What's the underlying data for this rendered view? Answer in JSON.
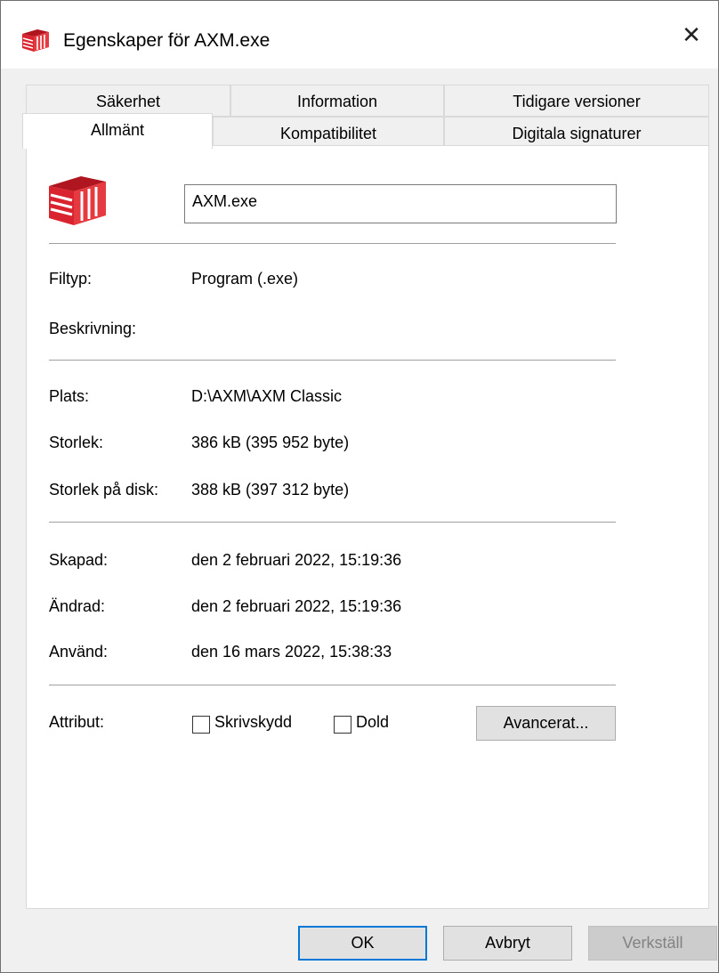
{
  "window": {
    "title": "Egenskaper för AXM.exe",
    "app_icon": "axm-logo-icon",
    "accent_color": "#d9232e"
  },
  "tabs": {
    "row1": [
      "Säkerhet",
      "Information",
      "Tidigare versioner"
    ],
    "row2": [
      "Allmänt",
      "Kompatibilitet",
      "Digitala signaturer"
    ],
    "active": "Allmänt"
  },
  "general": {
    "file_name": "AXM.exe",
    "filetype_label": "Filtyp:",
    "filetype_value": "Program (.exe)",
    "description_label": "Beskrivning:",
    "location_label": "Plats:",
    "location_value": "D:\\AXM\\AXM Classic",
    "size_label": "Storlek:",
    "size_value": "386 kB (395 952 byte)",
    "disk_size_label": "Storlek på disk:",
    "disk_size_value": "388 kB (397 312 byte)",
    "created_label": "Skapad:",
    "created_value": "den 2 februari 2022, 15:19:36",
    "modified_label": "Ändrad:",
    "modified_value": "den 2 februari 2022, 15:19:36",
    "accessed_label": "Använd:",
    "accessed_value": "den 16 mars 2022, 15:38:33",
    "attributes_label": "Attribut:",
    "readonly_label": "Skrivskydd",
    "readonly_checked": false,
    "hidden_label": "Dold",
    "hidden_checked": false,
    "advanced_label": "Avancerat..."
  },
  "footer": {
    "ok_label": "OK",
    "cancel_label": "Avbryt",
    "apply_label": "Verkställ"
  }
}
